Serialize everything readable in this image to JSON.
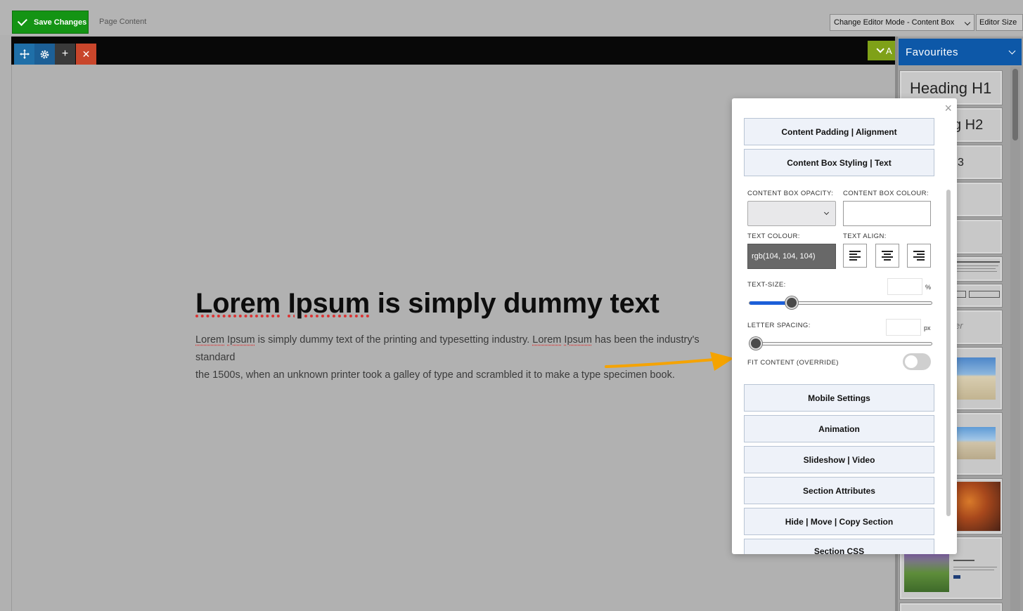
{
  "toolbar": {
    "save_label": "Save Changes",
    "page_label": "Page Content",
    "mode_label": "Change Editor Mode - Content Box",
    "size_label": "Editor Size"
  },
  "editor": {
    "heading_parts": [
      "Lorem",
      " ",
      "Ipsum",
      " is simply dummy text"
    ],
    "paragraph_line1_parts": [
      "Lorem",
      " ",
      "Ipsum",
      " is simply dummy text of the printing and typesetting industry. ",
      "Lorem",
      " ",
      "Ipsum",
      " has been the industry's standard"
    ],
    "paragraph_line2": "the 1500s, when an unknown printer took a galley of type and scrambled it to make a type specimen book.",
    "green_tab_letter": "A"
  },
  "favourites": {
    "title": "Favourites",
    "cards": [
      "Heading H1",
      "g H2",
      "3",
      "er"
    ]
  },
  "modal": {
    "close_glyph": "×",
    "sections_top": [
      "Content Padding | Alignment",
      "Content Box Styling | Text"
    ],
    "opacity_label": "CONTENT BOX OPACITY:",
    "colour_label": "CONTENT BOX COLOUR:",
    "opacity_value": "",
    "colour_value": "",
    "text_colour_label": "TEXT COLOUR:",
    "text_colour_value": "rgb(104, 104, 104)",
    "text_align_label": "TEXT ALIGN:",
    "text_size_label": "TEXT-SIZE:",
    "text_size_unit": "%",
    "text_size_slider": 0.23,
    "letter_spacing_label": "LETTER SPACING:",
    "letter_spacing_unit": "px",
    "letter_spacing_slider": 0.0,
    "fit_content_label": "FIT CONTENT (OVERRIDE)",
    "fit_content_on": false,
    "sections_bottom": [
      "Mobile Settings",
      "Animation",
      "Slideshow | Video",
      "Section Attributes",
      "Hide | Move | Copy Section",
      "Section CSS"
    ]
  },
  "colors": {
    "save_green": "#149414",
    "favourites_blue": "#0d58a8",
    "slider_blue": "#1c5fd8",
    "arrow_orange": "#f5a300",
    "delete_red": "#c9462b"
  }
}
